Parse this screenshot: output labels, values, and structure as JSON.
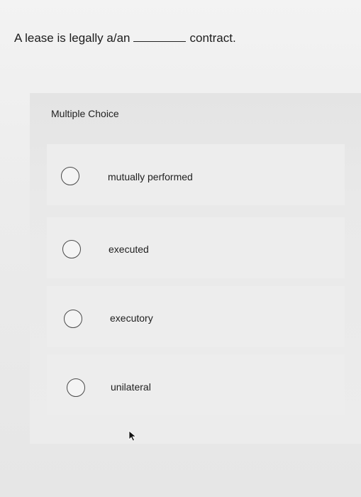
{
  "question": {
    "prefix": "A lease is legally a/an",
    "suffix": "contract."
  },
  "mc": {
    "label": "Multiple Choice",
    "options": [
      {
        "label": "mutually performed",
        "selected": false
      },
      {
        "label": "executed",
        "selected": false
      },
      {
        "label": "executory",
        "selected": false
      },
      {
        "label": "unilateral",
        "selected": false
      }
    ]
  },
  "icons": {
    "radio": "radio-empty-icon",
    "cursor": "mouse-pointer-icon"
  }
}
